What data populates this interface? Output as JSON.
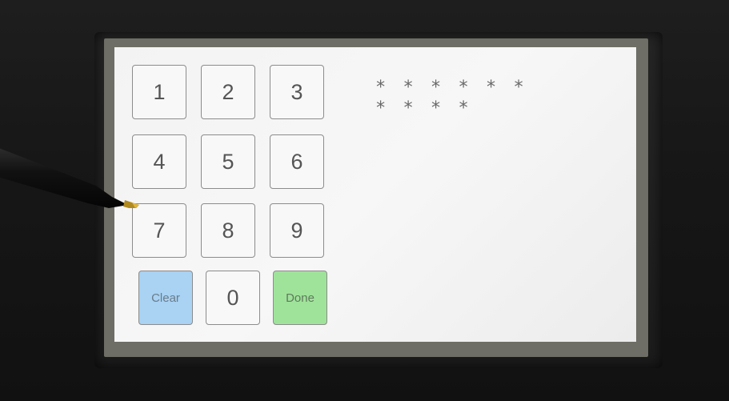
{
  "keypad": {
    "keys": [
      {
        "label": "1",
        "type": "digit"
      },
      {
        "label": "2",
        "type": "digit"
      },
      {
        "label": "3",
        "type": "digit"
      },
      {
        "label": "4",
        "type": "digit"
      },
      {
        "label": "5",
        "type": "digit"
      },
      {
        "label": "6",
        "type": "digit"
      },
      {
        "label": "7",
        "type": "digit"
      },
      {
        "label": "8",
        "type": "digit"
      },
      {
        "label": "9",
        "type": "digit"
      },
      {
        "label": "Clear",
        "type": "clear"
      },
      {
        "label": "0",
        "type": "digit"
      },
      {
        "label": "Done",
        "type": "done"
      }
    ]
  },
  "pin_display": {
    "line1": "* * * * * *",
    "line2": "* * * *"
  },
  "colors": {
    "clear_key": "#a9d2f3",
    "done_key": "#9fe39a",
    "screen_bg": "#f4f4f4"
  }
}
